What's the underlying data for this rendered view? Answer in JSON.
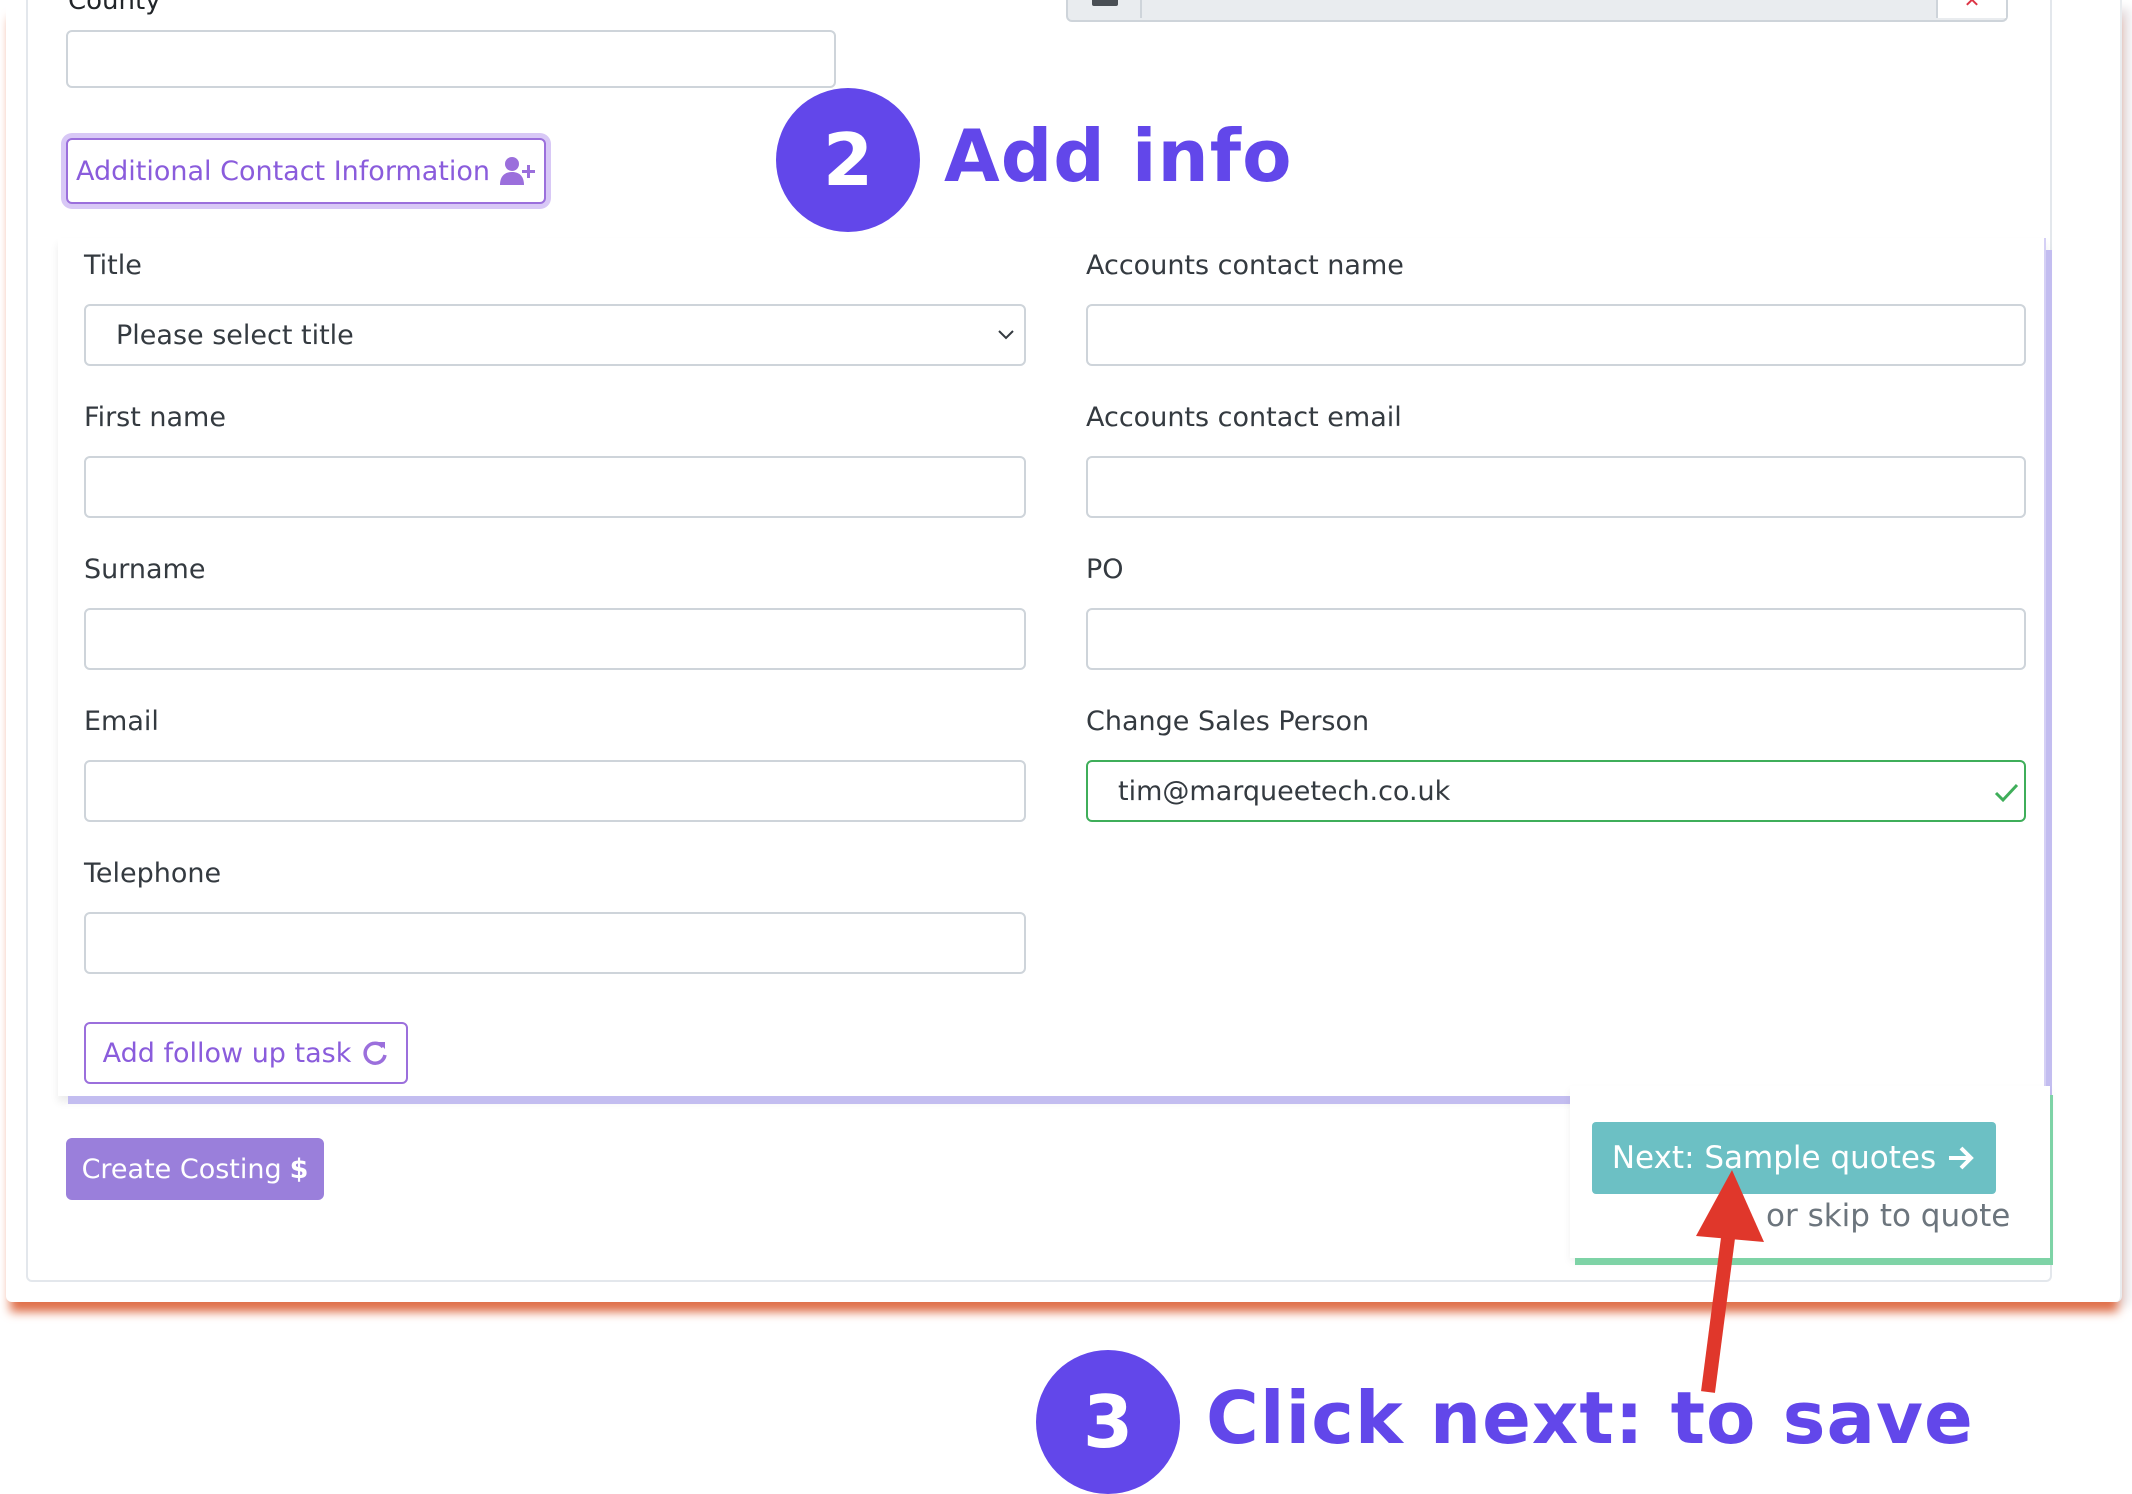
{
  "top": {
    "county_label": "County",
    "county_value": "",
    "remove_icon": "x-icon"
  },
  "additional_contact_button": {
    "label": "Additional Contact Information",
    "icon": "user-plus-icon"
  },
  "callouts": {
    "step2_number": "2",
    "step2_text": "Add info",
    "step3_number": "3",
    "step3_text": "Click next: to save"
  },
  "form": {
    "title_label": "Title",
    "title_value": "Please select title",
    "first_name_label": "First name",
    "first_name_value": "",
    "surname_label": "Surname",
    "surname_value": "",
    "email_label": "Email",
    "email_value": "",
    "telephone_label": "Telephone",
    "telephone_value": "",
    "accounts_name_label": "Accounts contact name",
    "accounts_name_value": "",
    "accounts_email_label": "Accounts contact email",
    "accounts_email_value": "",
    "po_label": "PO",
    "po_value": "",
    "sales_person_label": "Change Sales Person",
    "sales_person_value": "tim@marqueetech.co.uk"
  },
  "follow_up_button": {
    "label": "Add follow up task",
    "icon": "refresh-icon"
  },
  "create_costing_button": {
    "label": "Create Costing",
    "icon": "dollar-icon"
  },
  "next_button": {
    "label": "Next: Sample quotes",
    "icon": "arrow-right-icon"
  },
  "skip_link": "or skip to quote",
  "colors": {
    "accent_purple": "#6247ea",
    "button_purple": "#9a7fdb",
    "next_teal": "#6cc0c4",
    "valid_green": "#3fae5a",
    "annotation_arrow": "#e0372b"
  }
}
